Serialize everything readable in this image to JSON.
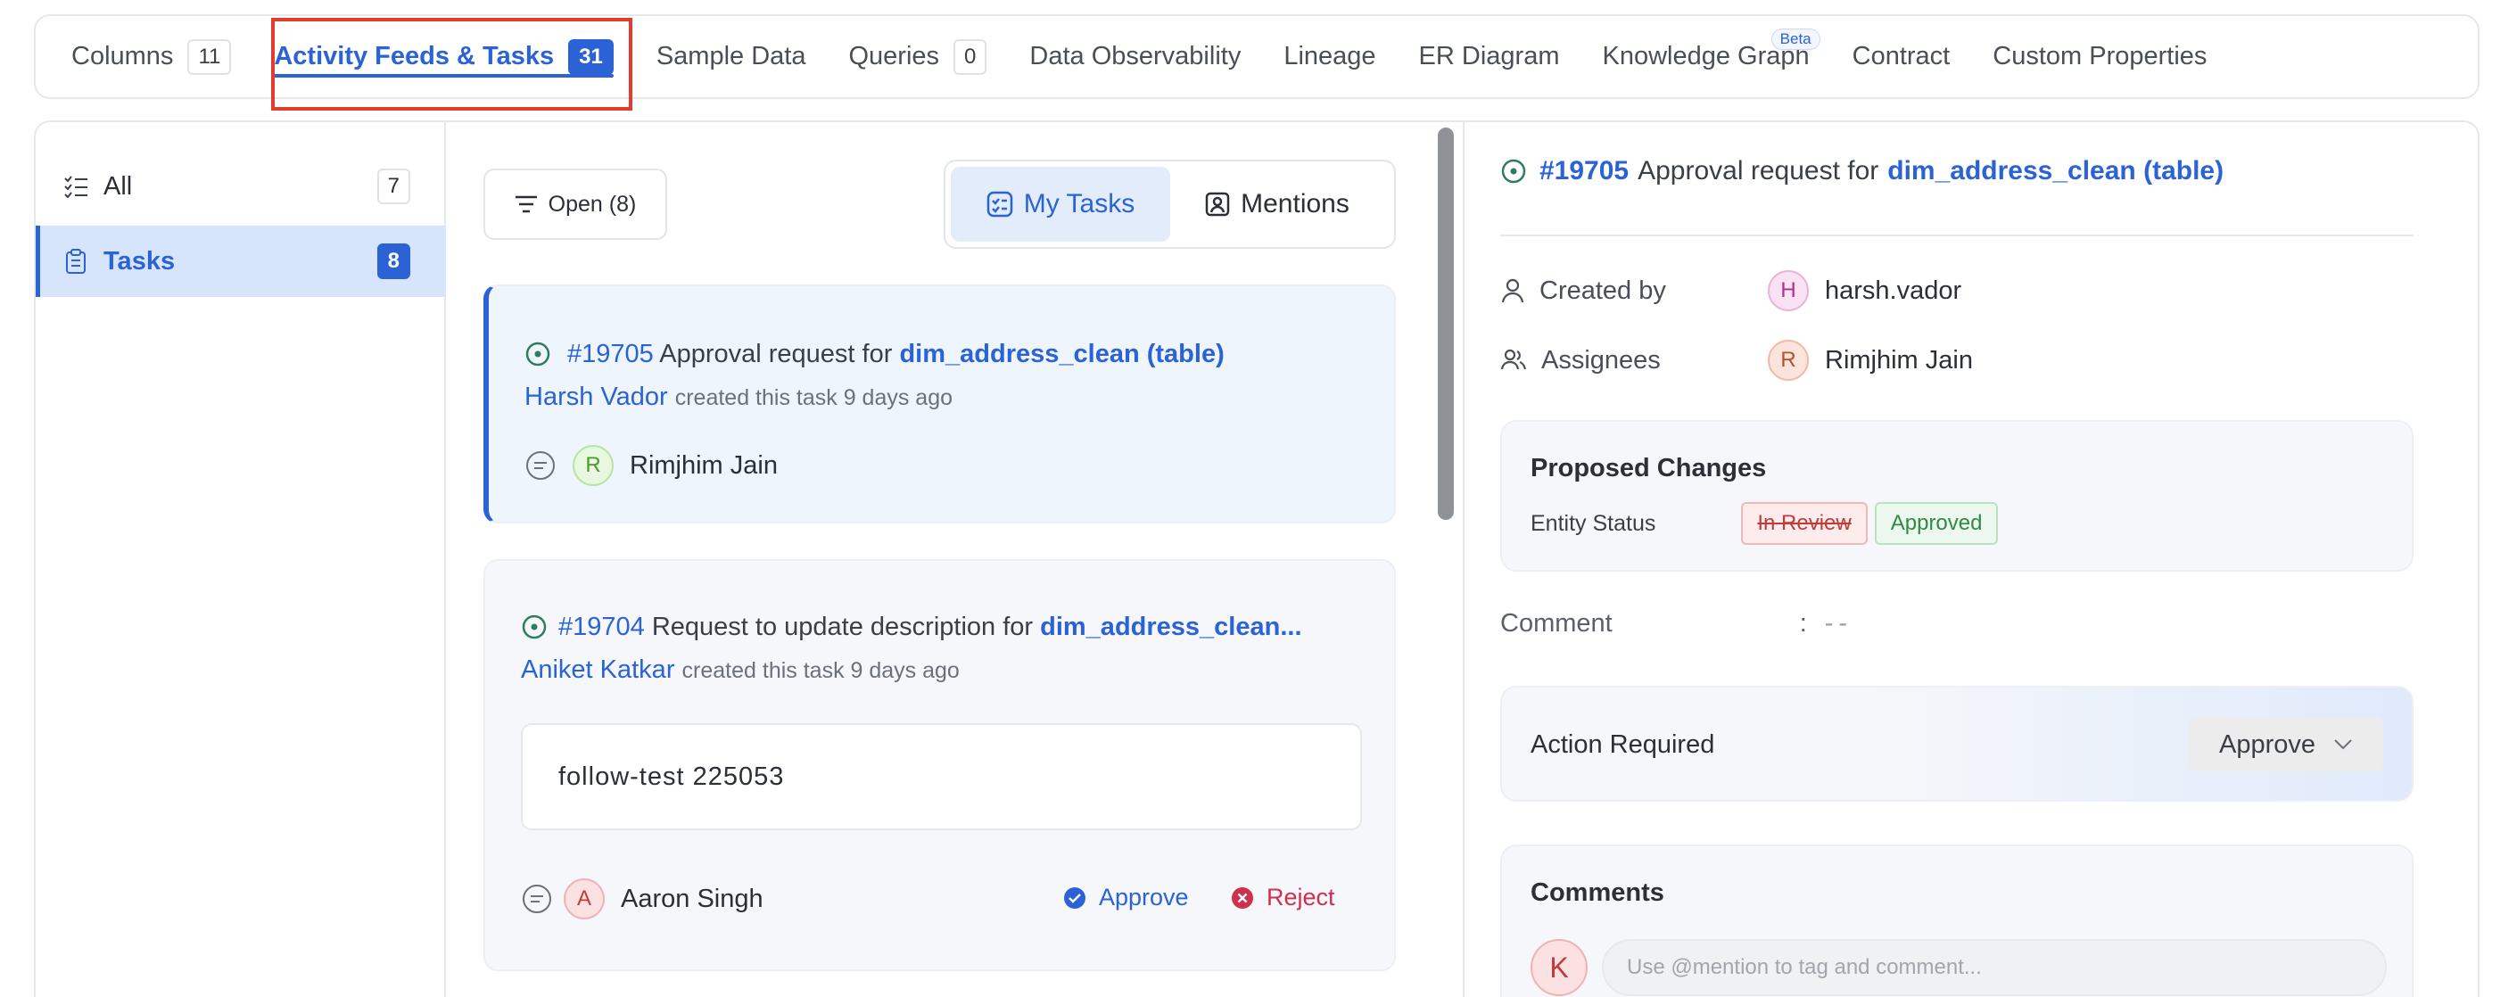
{
  "tabs": [
    {
      "label": "Columns",
      "count": "11"
    },
    {
      "label": "Activity Feeds & Tasks",
      "count": "31"
    },
    {
      "label": "Sample Data"
    },
    {
      "label": "Queries",
      "count": "0"
    },
    {
      "label": "Data Observability"
    },
    {
      "label": "Lineage"
    },
    {
      "label": "ER Diagram"
    },
    {
      "label": "Knowledge Graph",
      "badge": "Beta"
    },
    {
      "label": "Contract"
    },
    {
      "label": "Custom Properties"
    }
  ],
  "left_nav": [
    {
      "label": "All",
      "count": "7"
    },
    {
      "label": "Tasks",
      "count": "8"
    }
  ],
  "filter": {
    "label": "Open (8)"
  },
  "segment": {
    "my_tasks": "My Tasks",
    "mentions": "Mentions"
  },
  "tasks": [
    {
      "number": "#19705",
      "text": "Approval request for",
      "entity": "dim_address_clean (table)",
      "author": "Harsh Vador",
      "meta": "created this task 9 days ago",
      "assignee_initial": "R",
      "assignee": "Rimjhim Jain"
    },
    {
      "number": "#19704",
      "text": "Request to update description for",
      "entity": "dim_address_clean...",
      "author": "Aniket Katkar",
      "meta": "created this task 9 days ago",
      "description": "follow-test 225053",
      "assignee_initial": "A",
      "assignee": "Aaron Singh",
      "approve_label": "Approve",
      "reject_label": "Reject"
    }
  ],
  "detail": {
    "number": "#19705",
    "text": "Approval request for",
    "entity": "dim_address_clean (table)",
    "created_by_label": "Created by",
    "created_by_initial": "H",
    "created_by": "harsh.vador",
    "assignees_label": "Assignees",
    "assignee_initial": "R",
    "assignee": "Rimjhim Jain",
    "proposed_title": "Proposed Changes",
    "entity_status_label": "Entity Status",
    "old_status": "In Review",
    "new_status": "Approved",
    "comment_label": "Comment",
    "comment_colon": ":",
    "comment_value": "--",
    "action_required": "Action Required",
    "action_value": "Approve",
    "comments_title": "Comments",
    "commenter_initial": "K",
    "comment_placeholder": "Use @mention to tag and comment..."
  },
  "colors": {
    "accent": "#2b63d6",
    "highlight": "#e33b2c",
    "approve": "#2e8a44",
    "reject": "#d12f4e"
  }
}
